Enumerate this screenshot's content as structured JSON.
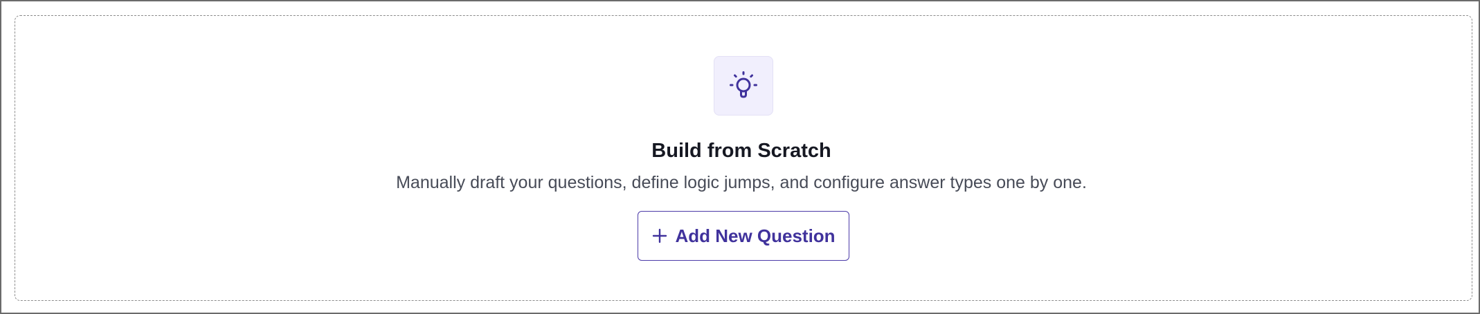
{
  "empty_state": {
    "icon": "lightbulb-icon",
    "title": "Build from Scratch",
    "description": "Manually draft your questions, define logic jumps, and configure answer types one by one.",
    "add_button": {
      "label": "Add New Question",
      "icon": "plus-icon"
    }
  },
  "colors": {
    "accent": "#40329c",
    "icon_tile_bg": "#f1effd",
    "title": "#161822",
    "description": "#474b57",
    "panel_border": "#8a8a8a"
  }
}
